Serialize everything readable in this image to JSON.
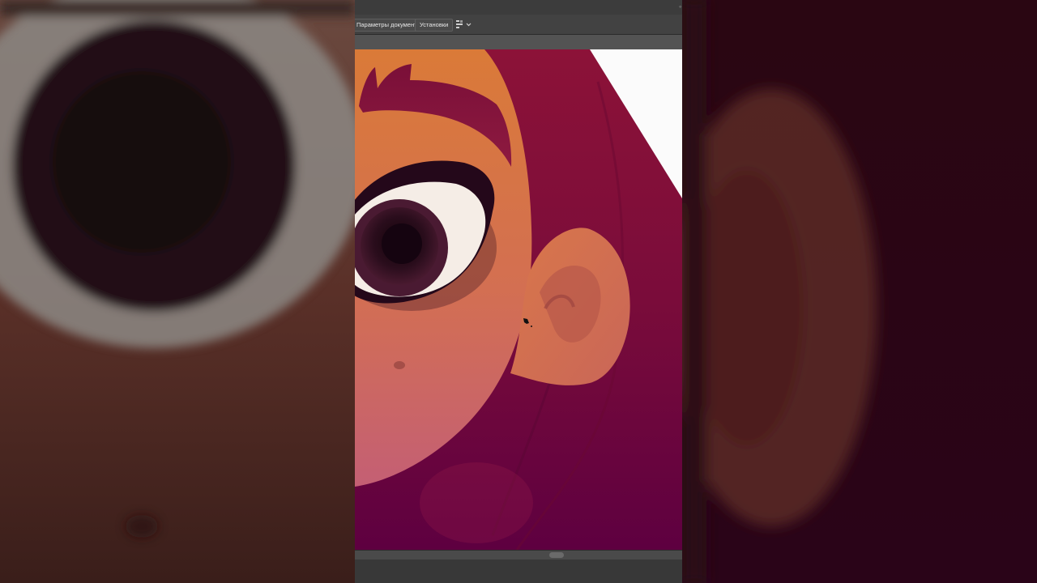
{
  "toolbar": {
    "doc_settings_label": "Параметры документа",
    "preferences_label": "Установки",
    "arrange_icon": "arrange-documents-icon"
  },
  "colors": {
    "hair_dark": "#5c0030",
    "hair_mid": "#8a1040",
    "skin_top": "#d9773c",
    "skin_bottom": "#d06868",
    "eye_white": "#f7efe9",
    "pupil": "#1e0612",
    "paper_white": "#ffffff",
    "panel_bg": "#424242"
  }
}
